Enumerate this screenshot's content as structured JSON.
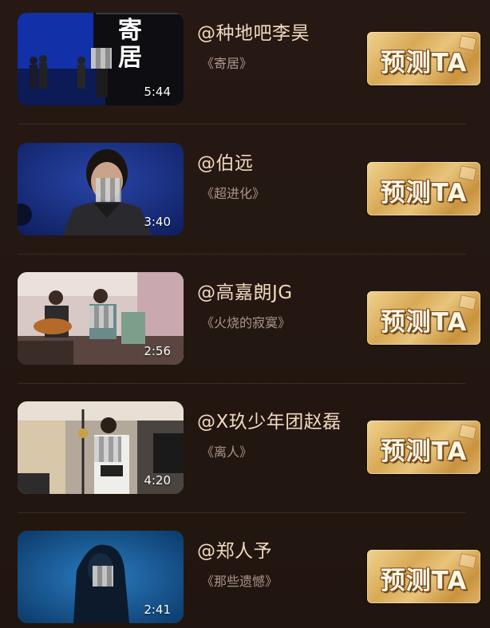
{
  "items": [
    {
      "author": "@种地吧李昊",
      "song": "《寄居》",
      "duration": "5:44",
      "button": "预测TA",
      "poster_title": "寄居"
    },
    {
      "author": "@伯远",
      "song": "《超进化》",
      "duration": "3:40",
      "button": "预测TA"
    },
    {
      "author": "@高嘉朗JG",
      "song": "《火烧的寂寞》",
      "duration": "2:56",
      "button": "预测TA"
    },
    {
      "author": "@X玖少年团赵磊",
      "song": "《离人》",
      "duration": "4:20",
      "button": "预测TA"
    },
    {
      "author": "@郑人予",
      "song": "《那些遗憾》",
      "duration": "2:41",
      "button": "预测TA"
    }
  ],
  "icons": [
    "stamp-icon"
  ],
  "colors": {
    "background": "#241713",
    "author_text": "#f1d9bd",
    "song_text": "#a8958a",
    "button_gold": "#d8a955"
  }
}
